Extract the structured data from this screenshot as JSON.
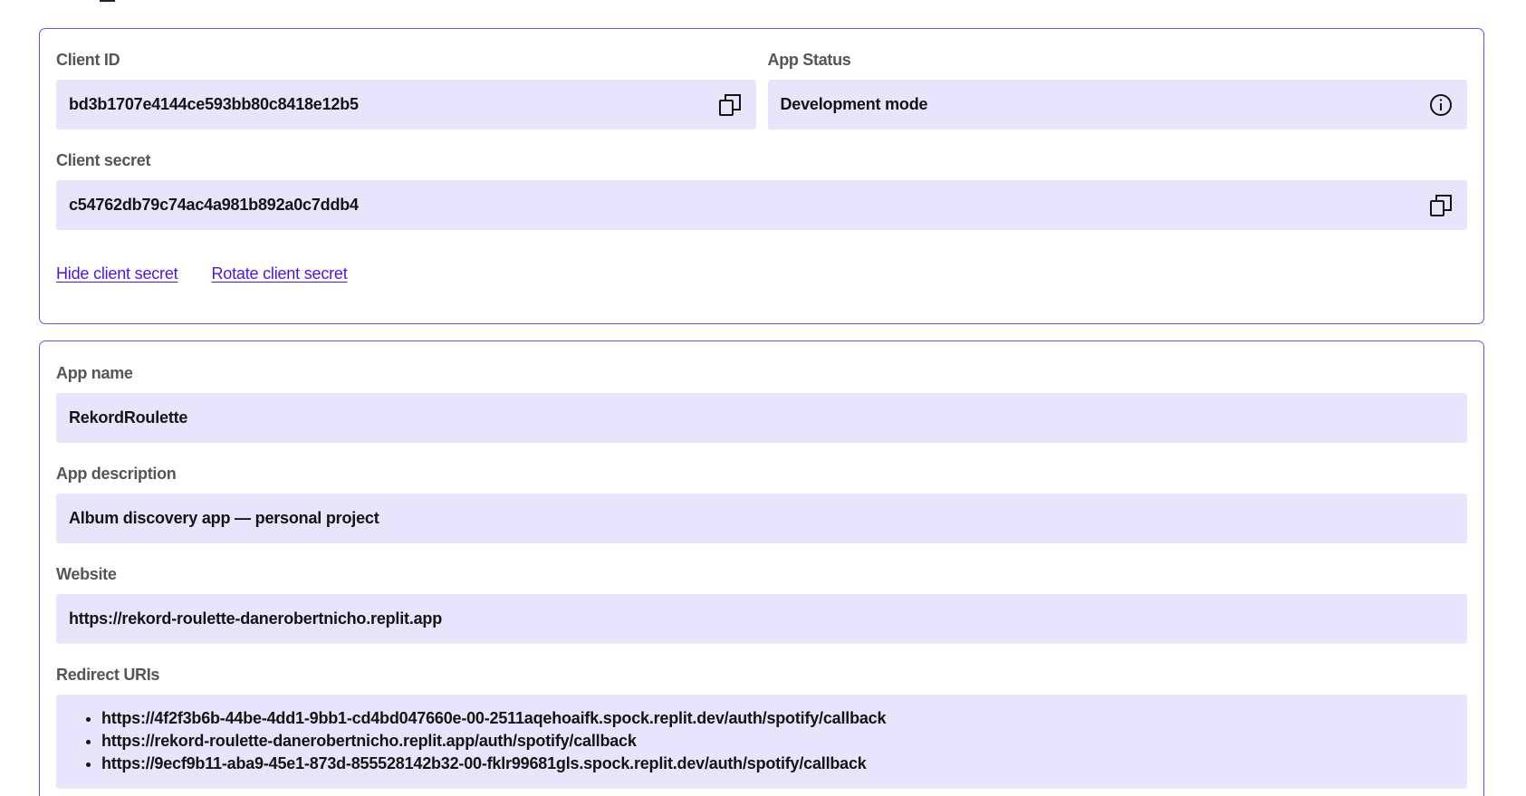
{
  "credentials": {
    "client_id_label": "Client ID",
    "client_id_value": "bd3b1707e4144ce593bb80c8418e12b5",
    "app_status_label": "App Status",
    "app_status_value": "Development mode",
    "client_secret_label": "Client secret",
    "client_secret_value": "c54762db79c74ac4a981b892a0c7ddb4",
    "hide_secret_link": "Hide client secret",
    "rotate_secret_link": "Rotate client secret"
  },
  "details": {
    "app_name_label": "App name",
    "app_name_value": "RekordRoulette",
    "app_description_label": "App description",
    "app_description_value": "Album discovery app — personal project",
    "website_label": "Website",
    "website_value": "https://rekord-roulette-danerobertnicho.replit.app",
    "redirect_uris_label": "Redirect URIs",
    "redirect_uris": [
      "https://4f2f3b6b-44be-4dd1-9bb1-cd4bd047660e-00-2511aqehoaifk.spock.replit.dev/auth/spotify/callback",
      "https://rekord-roulette-danerobertnicho.replit.app/auth/spotify/callback",
      "https://9ecf9b11-aba9-45e1-873d-855528142b32-00-fklr99681gls.spock.replit.dev/auth/spotify/callback"
    ]
  },
  "icons": {
    "copy": "copy-icon",
    "info": "info-icon"
  },
  "colors": {
    "accent_border": "#7a4cf0",
    "field_background": "#e8e4fb",
    "link": "#4c18d6"
  }
}
